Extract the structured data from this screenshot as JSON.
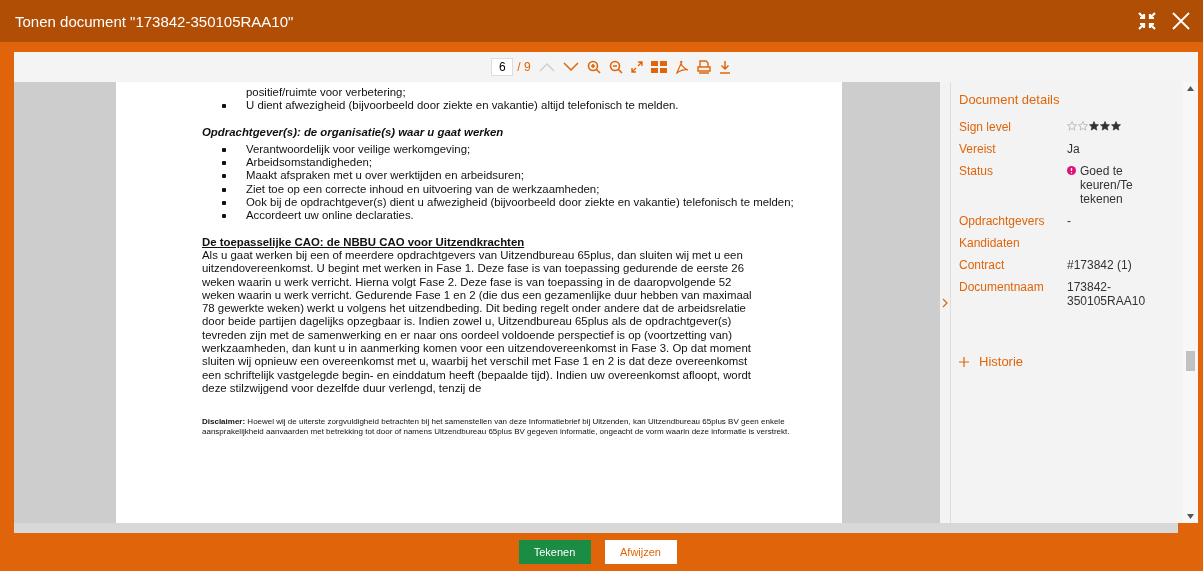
{
  "window": {
    "title": "Tonen document \"173842-350105RAA10\""
  },
  "toolbar": {
    "page": "6",
    "total": "/ 9",
    "tools": [
      {
        "kind": "prev",
        "disabled": true
      },
      {
        "kind": "next",
        "disabled": false
      },
      {
        "kind": "zoom-in",
        "disabled": false
      },
      {
        "kind": "zoom-out",
        "disabled": false
      },
      {
        "kind": "fit",
        "disabled": false
      },
      {
        "kind": "thumbnails",
        "disabled": false
      },
      {
        "kind": "pdf",
        "disabled": false
      },
      {
        "kind": "print",
        "disabled": false
      },
      {
        "kind": "download",
        "disabled": false
      }
    ]
  },
  "document": {
    "blocks": [
      {
        "kind": "list",
        "items": [
          {
            "text": "positief/ruimte voor verbetering;",
            "bullet": false
          },
          {
            "text": "U dient afwezigheid (bijvoorbeeld door ziekte en vakantie) altijd telefonisch te melden.",
            "bullet": true
          }
        ]
      },
      {
        "kind": "subheading",
        "text": "Opdrachtgever(s): de organisatie(s) waar u gaat werken"
      },
      {
        "kind": "list",
        "items": [
          {
            "text": "Verantwoordelijk voor veilige werkomgeving;",
            "bullet": true
          },
          {
            "text": "Arbeidsomstandigheden;",
            "bullet": true
          },
          {
            "text": "Maakt afspraken met u over werktijden en arbeidsuren;",
            "bullet": true
          },
          {
            "text": "Ziet toe op een correcte inhoud en uitvoering van de werkzaamheden;",
            "bullet": true
          },
          {
            "text": "Ook bij de opdrachtgever(s) dient u afwezigheid (bijvoorbeeld door ziekte en vakantie) telefonisch te melden;",
            "bullet": true
          },
          {
            "text": "Accordeert uw online declaraties.",
            "bullet": true
          }
        ]
      },
      {
        "kind": "heading",
        "text": "De toepasselijke CAO: de NBBU CAO voor Uitzendkrachten"
      },
      {
        "kind": "paragraph",
        "text": "Als u gaat werken bij een of meerdere opdrachtgevers van Uitzendbureau 65plus, dan sluiten wij met u een uitzendovereenkomst. U begint met werken in Fase 1. Deze fase is van toepassing gedurende de eerste 26 weken waarin u werk verricht. Hierna volgt Fase 2. Deze fase is van toepassing in de daaropvolgende 52 weken waarin u werk verricht. Gedurende Fase 1 en 2 (die dus een gezamenlijke duur hebben van maximaal 78 gewerkte weken) werkt u volgens het uitzendbeding. Dit beding regelt onder andere dat de arbeidsrelatie door beide partijen dagelijks opzegbaar is. Indien zowel u, Uitzendbureau 65plus als de opdrachtgever(s) tevreden zijn met de samenwerking en er naar ons oordeel voldoende perspectief is op (voortzetting van) werkzaamheden, dan kunt u in aanmerking komen voor een uitzendovereenkomst in Fase 3. Op dat moment sluiten wij opnieuw een overeenkomst met u, waarbij het verschil met Fase 1 en 2 is dat deze overeenkomst een schriftelijk vastgelegde begin- en einddatum heeft (bepaalde tijd). Indien uw overeenkomst afloopt, wordt deze stilzwijgend voor dezelfde duur verlengd, tenzij de"
      },
      {
        "kind": "note",
        "text": "**Disclaimer:** Hoewel wij de uiterste zorgvuldigheid betrachten bij het samenstellen van deze Informatiebrief bij Uitzenden, kan Uitzendbureau 65plus BV geen enkele aansprakelijkheid aanvaarden met betrekking tot door of namens Uitzendbureau 65plus BV gegeven informatie, ongeacht de vorm waarin deze informatie is verstrekt."
      }
    ]
  },
  "details": {
    "title": "Document details",
    "fields": [
      {
        "kind": "stars",
        "label": "Sign level",
        "stars": 3
      },
      {
        "kind": "text",
        "label": "Vereist",
        "value": "Ja"
      },
      {
        "kind": "status",
        "label": "Status",
        "value": "Goed te keuren/Te tekenen"
      },
      {
        "kind": "text",
        "label": "Opdrachtgevers",
        "value": "-"
      },
      {
        "kind": "text",
        "label": "Kandidaten"
      },
      {
        "kind": "text",
        "label": "Contract",
        "value": "#173842 (1)"
      },
      {
        "kind": "text",
        "label": "Documentnaam",
        "value": "173842-350105RAA10"
      }
    ],
    "history": {
      "label": "Historie",
      "expanded": false
    }
  },
  "buttons": [
    {
      "kind": "primary",
      "label": "Tekenen"
    },
    {
      "kind": "secondary",
      "label": "Afwijzen"
    }
  ]
}
